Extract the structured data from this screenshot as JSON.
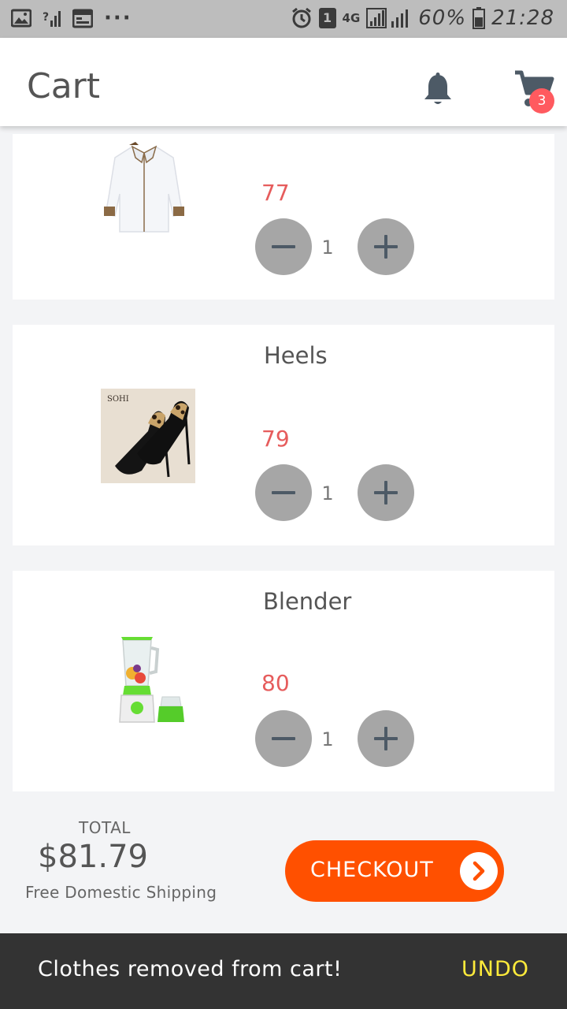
{
  "status_bar": {
    "network": "4G",
    "sim": "1",
    "battery": "60%",
    "time": "21:28",
    "more": "···"
  },
  "app_bar": {
    "title": "Cart",
    "cart_count": "3"
  },
  "cart_items": [
    {
      "name": "",
      "price": "77",
      "quantity": "1",
      "image": "white-shirt"
    },
    {
      "name": "Heels",
      "price": "79",
      "quantity": "1",
      "image": "black-leopard-heels"
    },
    {
      "name": "Blender",
      "price": "80",
      "quantity": "1",
      "image": "green-blender"
    }
  ],
  "summary": {
    "total_label": "TOTAL",
    "total_value": "$81.79",
    "shipping_note": "Free Domestic Shipping",
    "checkout_label": "CHECKOUT"
  },
  "snackbar": {
    "message": "Clothes removed from cart!",
    "action": "UNDO"
  },
  "colors": {
    "price": "#e65c5c",
    "checkout": "#ff5000",
    "badge": "#ff5a5f",
    "snack_action": "#ffeb3b"
  }
}
